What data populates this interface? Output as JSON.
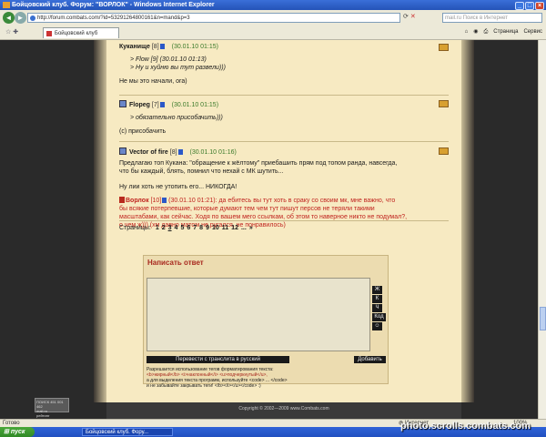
{
  "window": {
    "title": "Бойцовский клуб. Форум: \"ВОРЛОК\" - Windows Internet Explorer"
  },
  "address": {
    "url": "http://forum.combats.com/?id=53291264800161&n=mand&p=3"
  },
  "search": {
    "placeholder": "mail.ru Поиск в Интернет"
  },
  "tab": {
    "label": "Бойцовский клуб"
  },
  "tools": {
    "page": "Страница",
    "service": "Сервис"
  },
  "posts": [
    {
      "author": "Куканище",
      "level": "[8]",
      "date": "(30.01.10 01:15)",
      "quote": [
        "> Flow [9] (30.01.10 01:13)",
        "> Ну и хуйню вы тут развели)))"
      ],
      "text": "Не мы это начали, ога)"
    },
    {
      "author": "Flopeg",
      "level": "[7]",
      "date": "(30.01.10 01:15)",
      "quote": [
        "> обязательно присобачить)))"
      ],
      "text": "(с) присобачить"
    },
    {
      "author": "Vector of fire",
      "level": "[8]",
      "date": "(30.01.10 01:16)",
      "text_lines": [
        "Предлагаю топ Кукана: \"обращение к жёлтому\" приебашить прям под топом ранда, навсегда,",
        "что бы каждый, блять, помнил что нехай с МК шутить..."
      ],
      "text2": "Ну лии хоть не утопить его... НИКОГДА!"
    }
  ],
  "redpost": {
    "author": "Ворлок",
    "level": "[10]",
    "date": "(30.01.10 01:21):",
    "lines": [
      "да ебитесь вы тут хоть в сраку со своим мк, мне важно, что",
      "бы всякие потерпевшие, которые думают тем чем тут пишут персов не теряли такими",
      "масштабами, как сейчас. Ходя по вашем мего ссылкам, об этом то наверное никто не подумал?,",
      "о чем ж))) (хм давно матом не ругался, не понравилось)"
    ]
  },
  "pagination": {
    "label": "Страницы:",
    "pages": [
      "1",
      "2",
      "3",
      "4",
      "5",
      "6",
      "7",
      "8",
      "9",
      "10",
      "11",
      "12",
      "...",
      "»"
    ],
    "current": "3"
  },
  "write": {
    "title": "Написать ответ",
    "fmt_buttons": [
      "Ж",
      "К",
      "Ч",
      "Код"
    ],
    "translit": "Перевести с транслита в русский",
    "add": "Добавить",
    "hint": [
      "Разрешается использование тегов форматирования текста:",
      "<b>жирный</b> <i>наклонный</i> <u>подчеркнутый</u>,",
      "а для выделения текста программ, используйте <code> ... </code>",
      "и не забывайте закрывать теги! </b></i></u></code> :)"
    ]
  },
  "footer": {
    "copyright": "Copyright © 2002—2009 www.Combats.com"
  },
  "counter": {
    "lines": [
      "ПОИСК 451 001 462",
      "mail.ru",
      "рейтинг"
    ]
  },
  "status": {
    "left": "Готово",
    "zone": "Интернет",
    "zoom": "100%"
  },
  "taskbar": {
    "start": "пуск",
    "item": "Бойцовский клуб. Фору..."
  },
  "watermark": "photo.scrolls.combats.com"
}
